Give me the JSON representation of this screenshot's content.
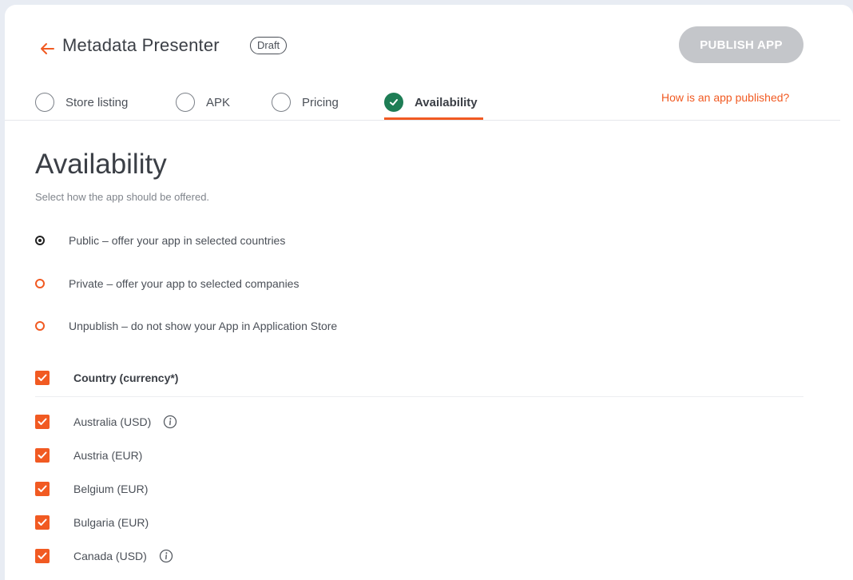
{
  "header": {
    "app_title": "Metadata Presenter",
    "status_badge": "Draft",
    "publish_label": "PUBLISH APP",
    "help_link": "How is an app published?"
  },
  "tabs": [
    {
      "label": "Store listing",
      "state": "incomplete"
    },
    {
      "label": "APK",
      "state": "incomplete"
    },
    {
      "label": "Pricing",
      "state": "incomplete"
    },
    {
      "label": "Availability",
      "state": "complete",
      "active": true
    }
  ],
  "availability": {
    "title": "Availability",
    "subtitle": "Select how the app should be offered.",
    "options": [
      {
        "label": "Public – offer your app in selected countries",
        "selected": true
      },
      {
        "label": "Private – offer your app to selected companies",
        "selected": false
      },
      {
        "label": "Unpublish – do not show your App in Application Store",
        "selected": false
      }
    ]
  },
  "countries": {
    "header_label": "Country (currency*)",
    "header_checked": true,
    "items": [
      {
        "label": "Australia (USD)",
        "checked": true,
        "info": true
      },
      {
        "label": "Austria (EUR)",
        "checked": true,
        "info": false
      },
      {
        "label": "Belgium (EUR)",
        "checked": true,
        "info": false
      },
      {
        "label": "Bulgaria (EUR)",
        "checked": true,
        "info": false
      },
      {
        "label": "Canada (USD)",
        "checked": true,
        "info": true
      }
    ]
  },
  "colors": {
    "accent": "#f15a22",
    "success": "#1e7d55",
    "disabled_button": "#c4c6ca",
    "background": "#e8ecf3"
  }
}
